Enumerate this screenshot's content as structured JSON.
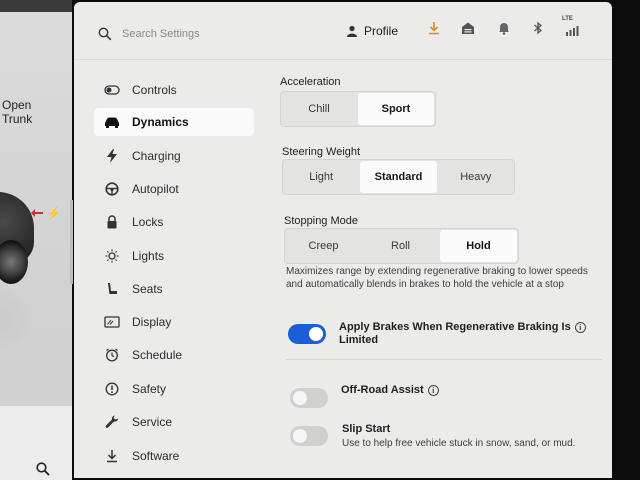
{
  "car_panel": {
    "trunk_line1": "Open",
    "trunk_line2": "Trunk"
  },
  "header": {
    "search_placeholder": "Search Settings",
    "profile_label": "Profile",
    "lte_label": "LTE",
    "icons": [
      "download-icon",
      "garage-icon",
      "bell-icon",
      "bluetooth-icon",
      "signal-icon"
    ]
  },
  "sidebar": {
    "items": [
      {
        "label": "Controls",
        "icon": "toggle-icon",
        "active": false
      },
      {
        "label": "Dynamics",
        "icon": "car-icon",
        "active": true
      },
      {
        "label": "Charging",
        "icon": "bolt-icon",
        "active": false
      },
      {
        "label": "Autopilot",
        "icon": "steering-wheel-icon",
        "active": false
      },
      {
        "label": "Locks",
        "icon": "lock-icon",
        "active": false
      },
      {
        "label": "Lights",
        "icon": "sun-icon",
        "active": false
      },
      {
        "label": "Seats",
        "icon": "seat-icon",
        "active": false
      },
      {
        "label": "Display",
        "icon": "display-icon",
        "active": false
      },
      {
        "label": "Schedule",
        "icon": "clock-icon",
        "active": false
      },
      {
        "label": "Safety",
        "icon": "alert-icon",
        "active": false
      },
      {
        "label": "Service",
        "icon": "wrench-icon",
        "active": false
      },
      {
        "label": "Software",
        "icon": "download-icon",
        "active": false
      }
    ]
  },
  "acceleration": {
    "title": "Acceleration",
    "options": [
      "Chill",
      "Sport"
    ],
    "selected": "Sport"
  },
  "steering": {
    "title": "Steering Weight",
    "options": [
      "Light",
      "Standard",
      "Heavy"
    ],
    "selected": "Standard"
  },
  "stopping": {
    "title": "Stopping Mode",
    "options": [
      "Creep",
      "Roll",
      "Hold"
    ],
    "selected": "Hold",
    "description": "Maximizes range by extending regenerative braking to lower speeds and automatically blends in brakes to hold the vehicle at a stop"
  },
  "apply_brakes": {
    "label_line1": "Apply Brakes When Regenerative Braking Is",
    "label_line2": "Limited",
    "enabled": true
  },
  "off_road": {
    "label": "Off-Road Assist",
    "enabled": false
  },
  "slip_start": {
    "label": "Slip Start",
    "sub": "Use to help free vehicle stuck in snow, sand, or mud.",
    "enabled": false
  },
  "colors": {
    "accent": "#1b5ed8",
    "background": "#ebebea",
    "selected_segment": "#fbfbfb"
  }
}
